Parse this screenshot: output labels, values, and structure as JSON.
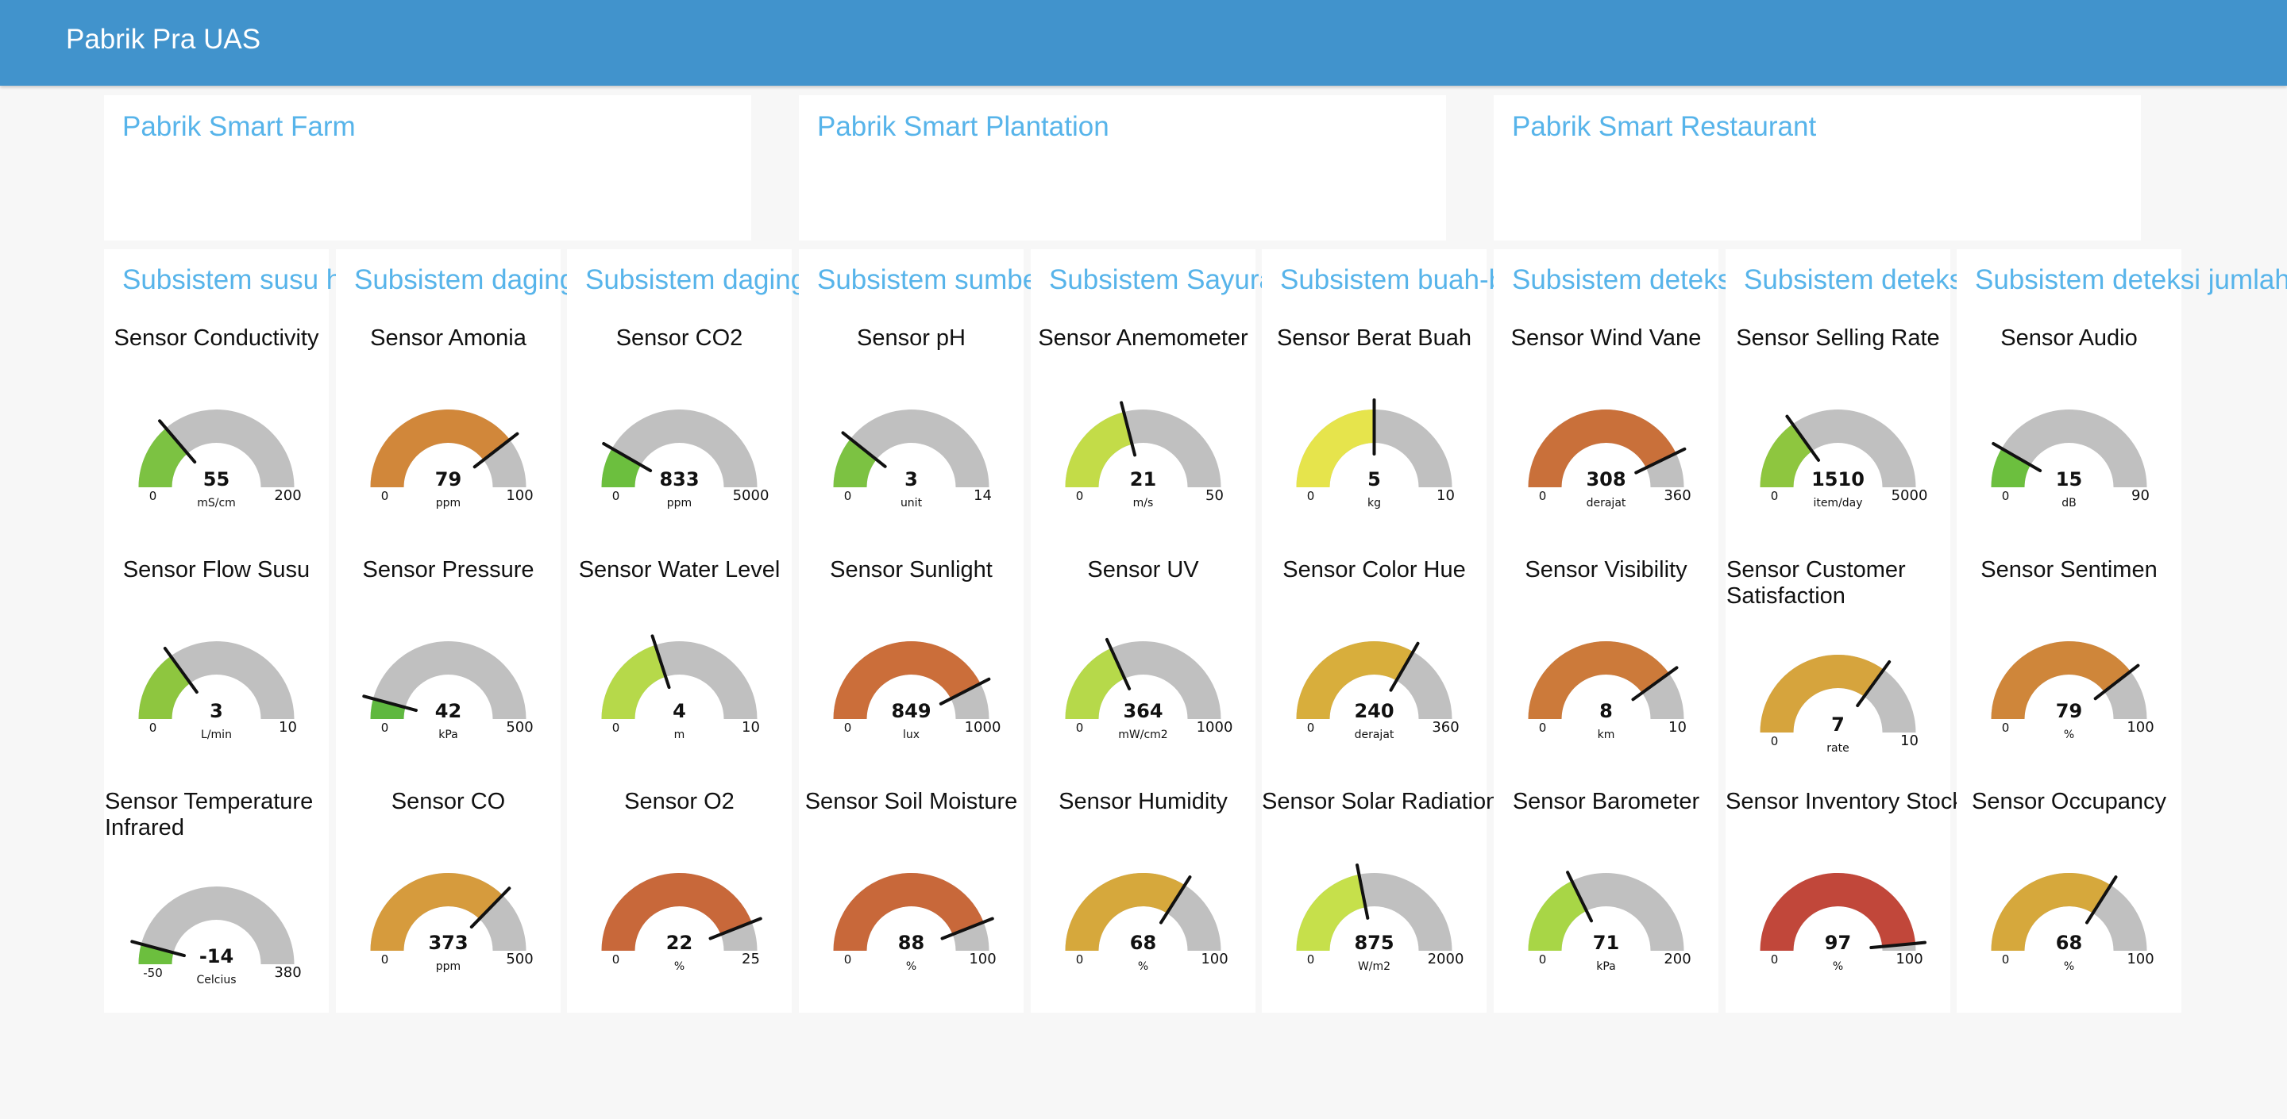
{
  "header": {
    "title": "Pabrik Pra UAS",
    "color": "#4193cc"
  },
  "groups": [
    {
      "title": "Pabrik Smart Farm"
    },
    {
      "title": "Pabrik Smart Plantation"
    },
    {
      "title": "Pabrik Smart Restaurant"
    }
  ],
  "columns": [
    {
      "title": "Subsistem susu hewani dan telur",
      "gauges": [
        {
          "label": "Sensor Conductivity",
          "value": 55,
          "min": 0,
          "max": 200,
          "unit": "mS/cm",
          "color": "#7cc242"
        },
        {
          "label": "Sensor Flow Susu",
          "value": 3,
          "min": 0,
          "max": 10,
          "unit": "L/min",
          "color": "#8ec63f"
        },
        {
          "label": "Sensor Temperature Infrared",
          "value": -14,
          "min": -50,
          "max": 380,
          "unit": "Celcius",
          "color": "#6cbf3e"
        }
      ]
    },
    {
      "title": "Subsistem daging merah",
      "gauges": [
        {
          "label": "Sensor Amonia",
          "value": 79,
          "min": 0,
          "max": 100,
          "unit": "ppm",
          "color": "#d1873a"
        },
        {
          "label": "Sensor Pressure",
          "value": 42,
          "min": 0,
          "max": 500,
          "unit": "kPa",
          "color": "#5fb83f"
        },
        {
          "label": "Sensor CO",
          "value": 373,
          "min": 0,
          "max": 500,
          "unit": "ppm",
          "color": "#d69b3d"
        }
      ]
    },
    {
      "title": "Subsistem daging putih",
      "gauges": [
        {
          "label": "Sensor CO2",
          "value": 833,
          "min": 0,
          "max": 5000,
          "unit": "ppm",
          "color": "#6cbf3e"
        },
        {
          "label": "Sensor Water Level",
          "value": 4,
          "min": 0,
          "max": 10,
          "unit": "m",
          "color": "#b6d94a"
        },
        {
          "label": "Sensor O2",
          "value": 22,
          "min": 0,
          "max": 25,
          "unit": "%",
          "color": "#c8683a"
        }
      ]
    },
    {
      "title": "Subsistem sumber",
      "gauges": [
        {
          "label": "Sensor pH",
          "value": 3,
          "min": 0,
          "max": 14,
          "unit": "unit",
          "color": "#7cc242"
        },
        {
          "label": "Sensor Sunlight",
          "value": 849,
          "min": 0,
          "max": 1000,
          "unit": "lux",
          "color": "#cb6e3a"
        },
        {
          "label": "Sensor Soil Moisture",
          "value": 88,
          "min": 0,
          "max": 100,
          "unit": "%",
          "color": "#c8683a"
        }
      ]
    },
    {
      "title": "Subsistem Sayuran",
      "gauges": [
        {
          "label": "Sensor Anemometer",
          "value": 21,
          "min": 0,
          "max": 50,
          "unit": "m/s",
          "color": "#c3dc48"
        },
        {
          "label": "Sensor UV",
          "value": 364,
          "min": 0,
          "max": 1000,
          "unit": "mW/cm2",
          "color": "#b6d94a"
        },
        {
          "label": "Sensor Humidity",
          "value": 68,
          "min": 0,
          "max": 100,
          "unit": "%",
          "color": "#d6a83c"
        }
      ]
    },
    {
      "title": "Subsistem buah-buahan",
      "gauges": [
        {
          "label": "Sensor Berat Buah",
          "value": 5,
          "min": 0,
          "max": 10,
          "unit": "kg",
          "color": "#e6e44c"
        },
        {
          "label": "Sensor Color Hue",
          "value": 240,
          "min": 0,
          "max": 360,
          "unit": "derajat",
          "color": "#d8ae3c"
        },
        {
          "label": "Sensor Solar Radiation",
          "value": 875,
          "min": 0,
          "max": 2000,
          "unit": "W/m2",
          "color": "#c6e04b"
        }
      ]
    },
    {
      "title": "Subsistem deteksi musim",
      "gauges": [
        {
          "label": "Sensor Wind Vane",
          "value": 308,
          "min": 0,
          "max": 360,
          "unit": "derajat",
          "color": "#c9703a"
        },
        {
          "label": "Sensor Visibility",
          "value": 8,
          "min": 0,
          "max": 10,
          "unit": "km",
          "color": "#cc7a3a"
        },
        {
          "label": "Sensor Barometer",
          "value": 71,
          "min": 0,
          "max": 200,
          "unit": "kPa",
          "color": "#a8d646"
        }
      ]
    },
    {
      "title": "Subsistem deteksi hasil",
      "gauges": [
        {
          "label": "Sensor Selling Rate",
          "value": 1510,
          "min": 0,
          "max": 5000,
          "unit": "item/day",
          "color": "#8ec63f"
        },
        {
          "label": "Sensor Customer Satisfaction",
          "value": 7,
          "min": 0,
          "max": 10,
          "unit": "rate",
          "color": "#d6a43d"
        },
        {
          "label": "Sensor Inventory Stock",
          "value": 97,
          "min": 0,
          "max": 100,
          "unit": "%",
          "color": "#c1473a"
        }
      ]
    },
    {
      "title": "Subsistem deteksi jumlah",
      "gauges": [
        {
          "label": "Sensor Audio",
          "value": 15,
          "min": 0,
          "max": 90,
          "unit": "dB",
          "color": "#6cbf3e"
        },
        {
          "label": "Sensor Sentimen",
          "value": 79,
          "min": 0,
          "max": 100,
          "unit": "%",
          "color": "#cf863a"
        },
        {
          "label": "Sensor Occupancy",
          "value": 68,
          "min": 0,
          "max": 100,
          "unit": "%",
          "color": "#d6a83c"
        }
      ]
    }
  ]
}
